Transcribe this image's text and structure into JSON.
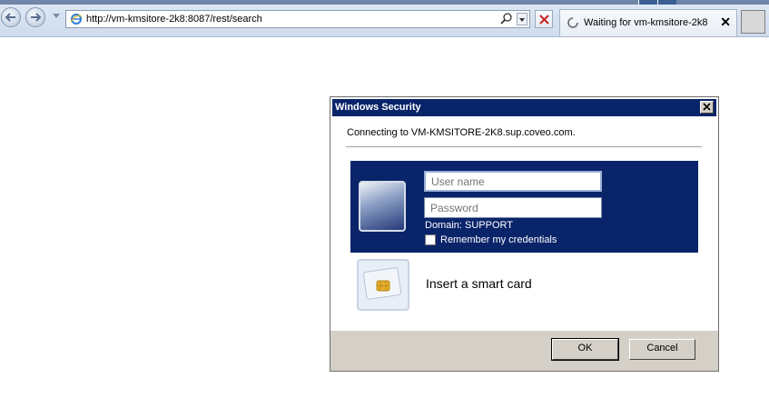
{
  "browser": {
    "address_url": "http://vm-kmsitore-2k8:8087/rest/search",
    "tab_title": "Waiting for vm-kmsitore-2k8",
    "tab_close": "✕"
  },
  "dialog": {
    "title": "Windows Security",
    "connecting_text": "Connecting to VM-KMSITORE-2K8.sup.coveo.com.",
    "username_placeholder": "User name",
    "password_placeholder": "Password",
    "domain_text": "Domain: SUPPORT",
    "remember_label": "Remember my credentials",
    "remember_checked": false,
    "smartcard_label": "Insert a smart card",
    "ok_label": "OK",
    "cancel_label": "Cancel"
  },
  "colors": {
    "titlebar": "#0a246a",
    "credential_panel": "#0a246a",
    "dialog_footer": "#d4d0c8"
  },
  "icons": {
    "back": "back-arrow-icon",
    "forward": "forward-arrow-icon",
    "page": "ie-page-icon",
    "search": "search-icon",
    "stop": "stop-icon",
    "loading": "loading-spinner-icon",
    "user": "user-tile-icon",
    "smartcard": "smart-card-icon"
  }
}
